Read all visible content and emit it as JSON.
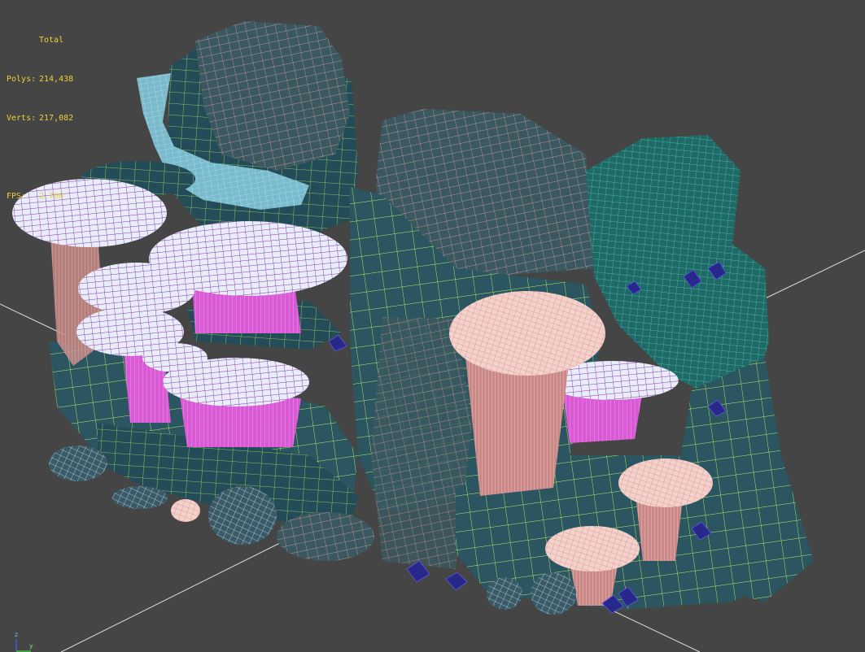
{
  "stats": {
    "title": "Total",
    "polys_label": "Polys:",
    "polys_value": "214,438",
    "verts_label": "Verts:",
    "verts_value": "217,082",
    "fps_label": "FPS:",
    "fps_value": "2.766"
  },
  "axis": {
    "z": "z",
    "y": "y"
  },
  "colors": {
    "background": "#454545",
    "stats_text": "#e8d23a",
    "rock_wire": "#c8f26a",
    "rock_fill": "#2c5560",
    "stone_wire": "#e8a0a8",
    "mushroom_purple_wire": "#8a2fb0",
    "mushroom_stem": "#e060d8",
    "coral_wire": "#f0a8a0",
    "foam_wire": "#9adcf0",
    "moss_wire": "#4fb8a8",
    "pebble_wire": "#b4d8f0",
    "crystal": "#2a2a8a"
  }
}
